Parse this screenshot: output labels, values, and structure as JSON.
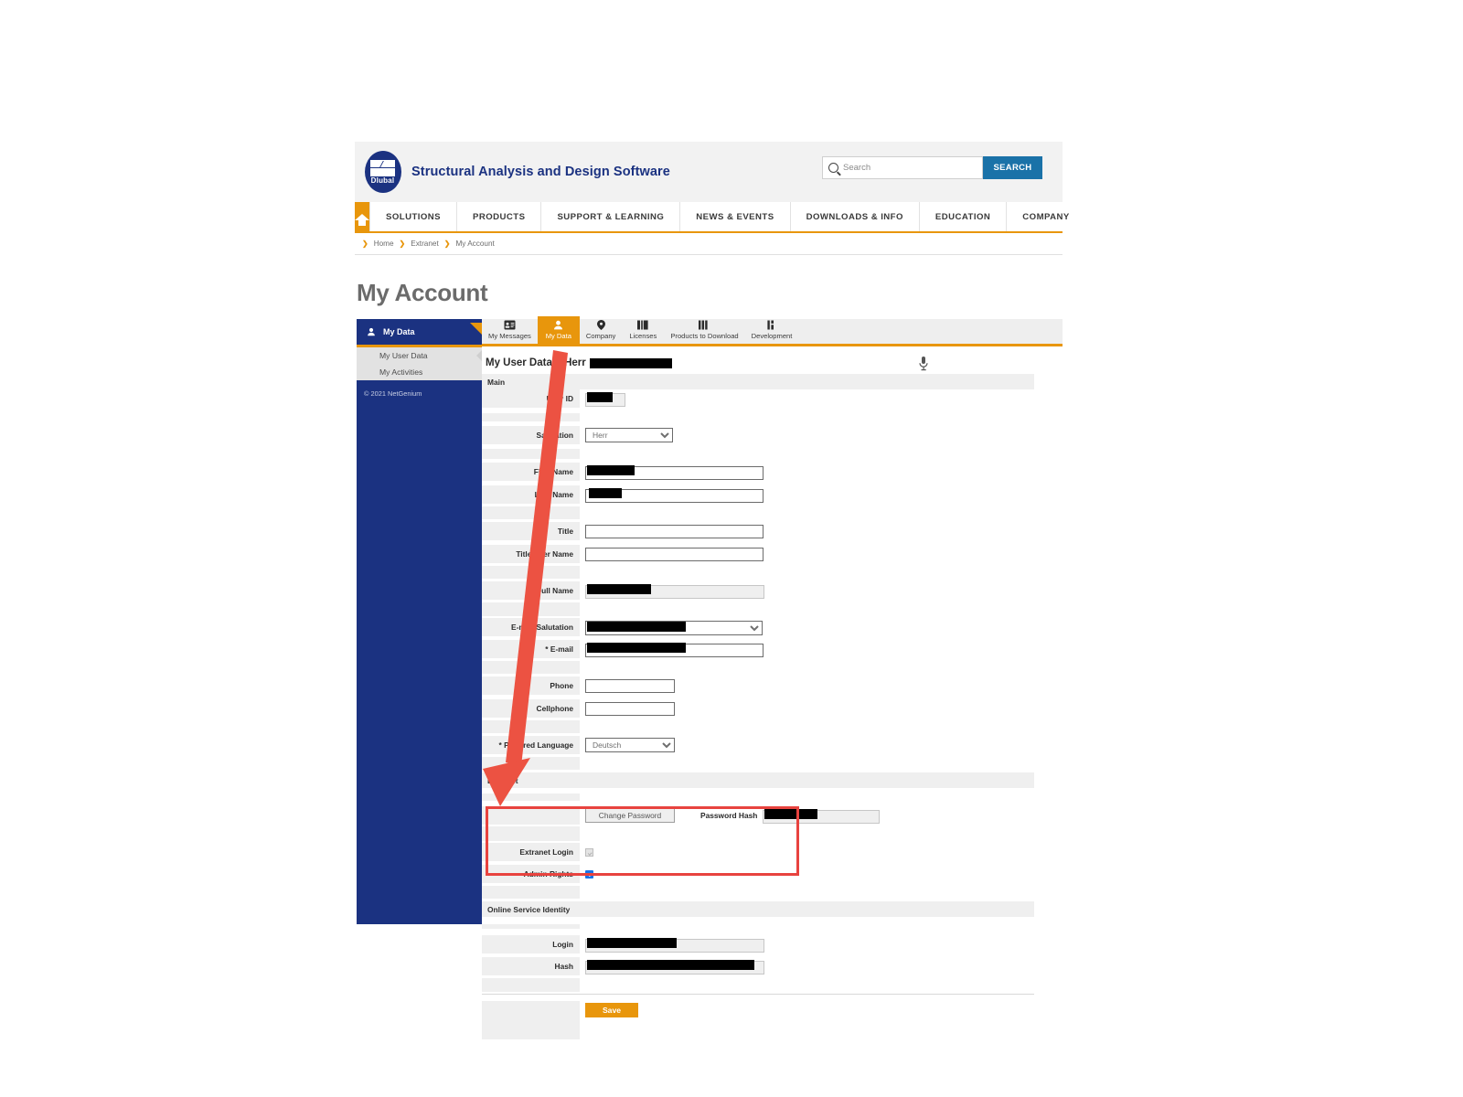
{
  "header": {
    "logo_text": "Dlubal",
    "site_title": "Structural Analysis and Design Software",
    "search_placeholder": "Search",
    "search_button": "SEARCH"
  },
  "main_nav": {
    "home_icon": "home-icon",
    "items": [
      {
        "label": "SOLUTIONS"
      },
      {
        "label": "PRODUCTS"
      },
      {
        "label": "SUPPORT & LEARNING"
      },
      {
        "label": "NEWS & EVENTS"
      },
      {
        "label": "DOWNLOADS & INFO"
      },
      {
        "label": "EDUCATION"
      },
      {
        "label": "COMPANY"
      }
    ]
  },
  "breadcrumb": {
    "items": [
      "Home",
      "Extranet",
      "My Account"
    ],
    "separator": "❯"
  },
  "page_title": "My Account",
  "sidebar": {
    "header_label": "My Data",
    "links": [
      {
        "label": "My User Data",
        "selected": true
      },
      {
        "label": "My Activities",
        "selected": false
      }
    ],
    "copyright": "© 2021 NetGenium"
  },
  "tabs": [
    {
      "label": "My Messages",
      "icon": "id-card-icon",
      "active": false
    },
    {
      "label": "My Data",
      "icon": "person-icon",
      "active": true
    },
    {
      "label": "Company",
      "icon": "map-pin-icon",
      "active": false
    },
    {
      "label": "Licenses",
      "icon": "license-bars-icon",
      "active": false
    },
    {
      "label": "Products to Download",
      "icon": "columns-icon",
      "active": false
    },
    {
      "label": "Development",
      "icon": "tools-icon",
      "active": false
    }
  ],
  "document": {
    "title_main": "My User Data",
    "title_divider": "|",
    "title_salutation": "Herr",
    "title_redacted": true,
    "mic_icon": "microphone-icon"
  },
  "sections": {
    "main": {
      "heading": "Main",
      "fields": [
        {
          "label": "User ID",
          "type": "readonly-short",
          "redacted": true
        },
        {
          "label": "Salutation",
          "type": "select",
          "value": "Herr"
        },
        {
          "label": "First Name",
          "type": "text",
          "redacted": true
        },
        {
          "label": "Last Name",
          "type": "text",
          "redacted": true
        },
        {
          "label": "Title",
          "type": "text",
          "redacted": false
        },
        {
          "label": "Title after Name",
          "type": "text",
          "redacted": false
        },
        {
          "label": "Full Name",
          "type": "readonly",
          "redacted": true
        },
        {
          "label": "E-mail Salutation",
          "type": "select-wide",
          "redacted": true
        },
        {
          "label": "* E-mail",
          "type": "text",
          "redacted": true
        },
        {
          "label": "Phone",
          "type": "text-short",
          "redacted": false
        },
        {
          "label": "Cellphone",
          "type": "text-short",
          "redacted": false
        },
        {
          "label": "* Prefered Language",
          "type": "select",
          "value": "Deutsch"
        }
      ]
    },
    "extranet": {
      "heading": "Extranet",
      "change_password_button": "Change Password",
      "password_hash_label": "Password Hash",
      "password_hash_redacted": true,
      "checkboxes": [
        {
          "label": "Extranet Login",
          "checked": true,
          "disabled": true
        },
        {
          "label": "Admin Rights",
          "checked": true,
          "disabled": false
        }
      ]
    },
    "online_service_identity": {
      "heading": "Online Service Identity",
      "highlighted": true,
      "highlight_color": "#e8433f",
      "fields": [
        {
          "label": "Login",
          "type": "readonly",
          "redacted": true
        },
        {
          "label": "Hash",
          "type": "readonly",
          "redacted": true
        }
      ]
    }
  },
  "save_button": "Save",
  "annotation": {
    "arrow_color": "#ec5242",
    "arrow_from": "my-data-tab",
    "arrow_to": "online-service-identity-section"
  },
  "colors": {
    "brand_blue": "#1b3281",
    "accent_orange": "#e8960c",
    "search_blue": "#1a72a8",
    "highlight_red": "#e8433f"
  }
}
